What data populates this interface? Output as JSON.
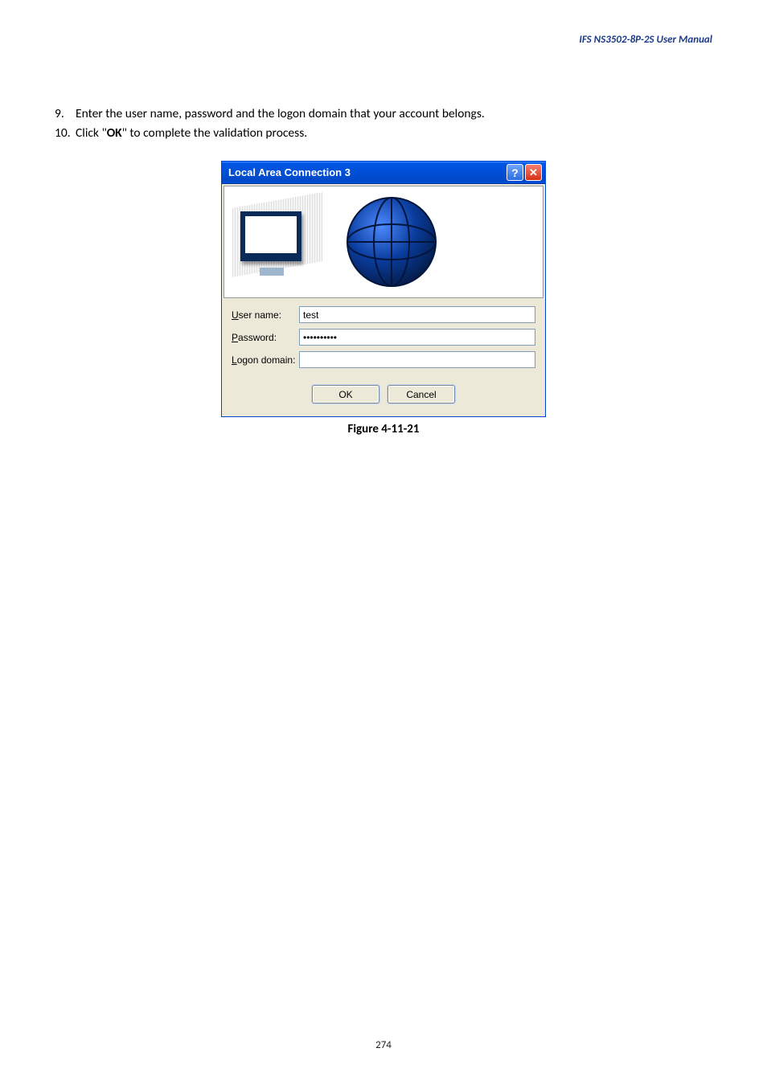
{
  "header": "IFS  NS3502-8P-2S  User  Manual",
  "steps": [
    {
      "n": "9.",
      "text_before": "Enter the user name, password and the logon domain that your account belongs.",
      "bold": "",
      "text_after": ""
    },
    {
      "n": "10.",
      "text_before": "Click \"",
      "bold": "OK",
      "text_after": "\" to complete the validation process."
    }
  ],
  "dialog": {
    "title": "Local Area Connection 3",
    "fields": {
      "username": {
        "label_pre": "U",
        "label_rest": "ser name:",
        "value": "test"
      },
      "password": {
        "label_pre": "P",
        "label_rest": "assword:",
        "value": "••••••••••"
      },
      "logondomain": {
        "label_pre": "L",
        "label_rest": "ogon domain:",
        "value": ""
      }
    },
    "buttons": {
      "ok": "OK",
      "cancel": "Cancel"
    }
  },
  "caption": "Figure 4-11-21",
  "page_number": "274"
}
